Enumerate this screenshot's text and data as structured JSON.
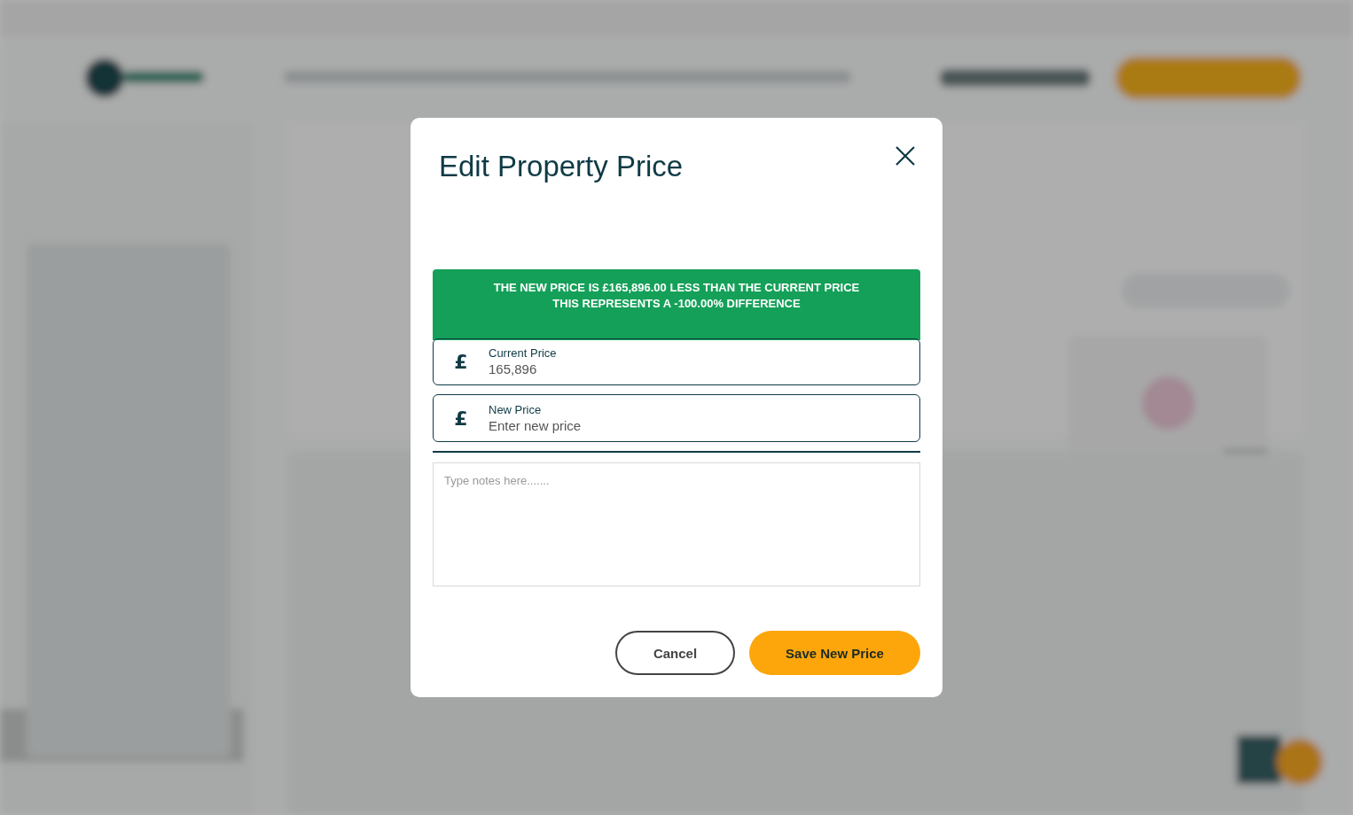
{
  "dialog": {
    "title": "Edit Property Price",
    "alert": {
      "kind": "success",
      "lines": [
        "THE NEW PRICE IS £165,896.00 LESS THAN THE CURRENT PRICE",
        "THIS REPRESENTS A -100.00% DIFFERENCE"
      ]
    },
    "fields": [
      {
        "currency_symbol": "£",
        "label": "Current Price",
        "value": "165,896"
      },
      {
        "currency_symbol": "£",
        "label": "New Price",
        "placeholder": "Enter new price"
      }
    ],
    "notes": {
      "placeholder": "Type notes here......."
    },
    "buttons": [
      {
        "kind": "secondary",
        "label": "Cancel"
      },
      {
        "kind": "primary",
        "label": "Save New Price"
      }
    ]
  }
}
